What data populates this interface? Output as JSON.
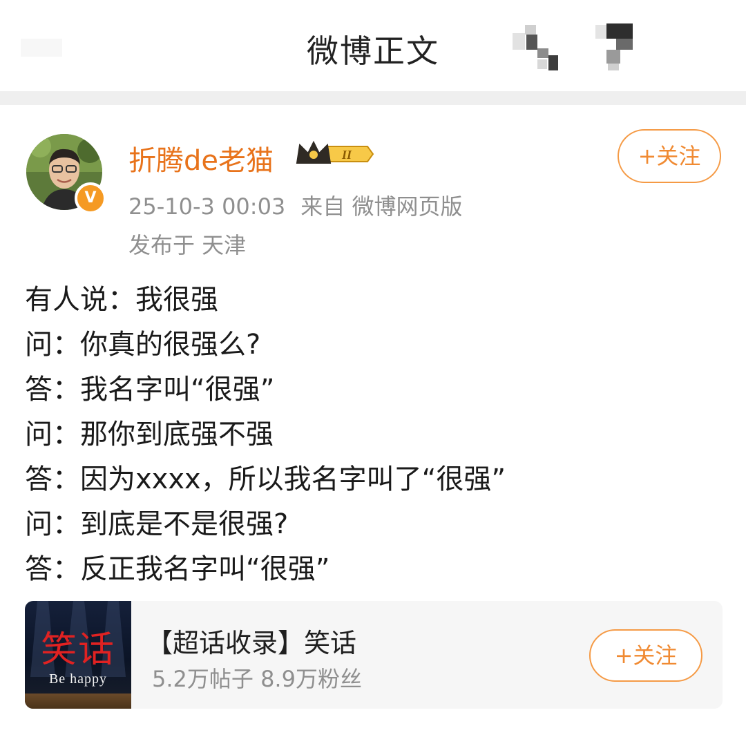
{
  "header": {
    "title": "微博正文"
  },
  "post": {
    "author": {
      "name": "折腾de老猫",
      "verified_badge": "V",
      "level_badge": "II"
    },
    "timestamp": "25-10-3 00:03",
    "source_label": "来自 微博网页版",
    "location": "发布于 天津",
    "follow_label": "+关注",
    "lines": [
      "有人说：我很强",
      "问：你真的很强么?",
      "答：我名字叫“很强”",
      "问：那你到底强不强",
      "答：因为xxxx，所以我名字叫了“很强”",
      "问：到底是不是很强?",
      "答：反正我名字叫“很强”"
    ]
  },
  "topic_card": {
    "thumbnail_title": "笑话",
    "thumbnail_subtitle": "Be happy",
    "title": "【超话收录】笑话",
    "stats": "5.2万帖子 8.9万粉丝",
    "follow_label": "+关注"
  },
  "colors": {
    "accent": "#E8731B",
    "follow_border": "#F59A45",
    "meta_text": "#8F8F8F",
    "separator": "#EFEFEF"
  }
}
